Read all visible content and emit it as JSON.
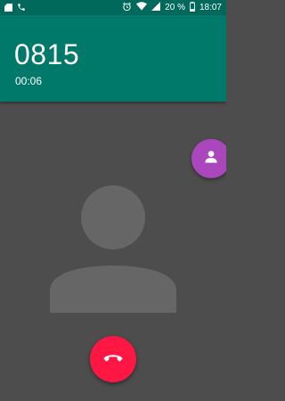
{
  "status_bar": {
    "battery_text": "20 %",
    "time": "18:07",
    "left_icons": [
      "sim-icon",
      "call-status-icon"
    ],
    "right_icons": [
      "alarm-icon",
      "wifi-icon",
      "signal-icon",
      "battery-icon"
    ]
  },
  "call": {
    "number": "0815",
    "duration": "00:06"
  },
  "actions": {
    "contact_icon": "person-icon",
    "end_call_icon": "call-end-icon"
  },
  "colors": {
    "status_bar": "#00695c",
    "header": "#00796b",
    "background": "#4d4d4d",
    "avatar": "#666666",
    "contact_fab": "#ab47bc",
    "end_call": "#ff1744"
  }
}
